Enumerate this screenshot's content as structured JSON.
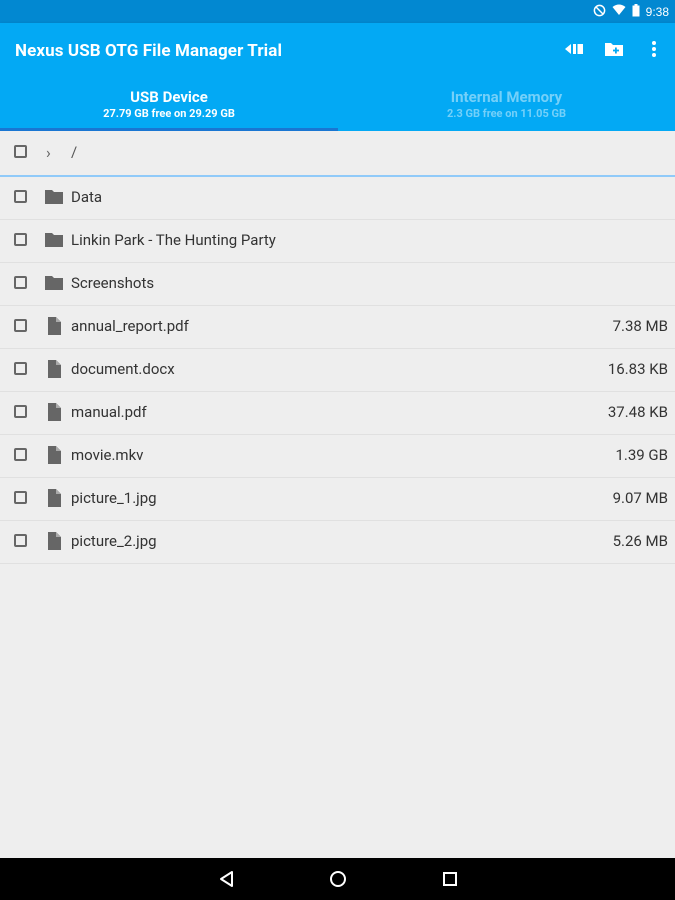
{
  "status_bar": {
    "time": "9:38",
    "icons": [
      "do-not-disturb-icon",
      "wifi-icon",
      "battery-icon"
    ]
  },
  "app_bar": {
    "title": "Nexus USB OTG File Manager Trial",
    "actions": [
      "sort-icon",
      "new-folder-icon",
      "overflow-menu-icon"
    ],
    "colors": {
      "primary": "#03a9f4",
      "status": "#0288d1",
      "indicator": "#1976d2"
    }
  },
  "tabs": [
    {
      "label": "USB Device",
      "sublabel": "27.79 GB free on 29.29 GB",
      "active": true
    },
    {
      "label": "Internal Memory",
      "sublabel": "2.3 GB free on 11.05 GB",
      "active": false
    }
  ],
  "path": {
    "current": "/"
  },
  "files": [
    {
      "name": "Data",
      "type": "folder",
      "size": ""
    },
    {
      "name": "Linkin Park - The Hunting Party",
      "type": "folder",
      "size": ""
    },
    {
      "name": "Screenshots",
      "type": "folder",
      "size": ""
    },
    {
      "name": "annual_report.pdf",
      "type": "file",
      "size": "7.38 MB"
    },
    {
      "name": "document.docx",
      "type": "file",
      "size": "16.83 KB"
    },
    {
      "name": "manual.pdf",
      "type": "file",
      "size": "37.48 KB"
    },
    {
      "name": "movie.mkv",
      "type": "file",
      "size": "1.39 GB"
    },
    {
      "name": "picture_1.jpg",
      "type": "file",
      "size": "9.07 MB"
    },
    {
      "name": "picture_2.jpg",
      "type": "file",
      "size": "5.26 MB"
    }
  ],
  "nav_bar": [
    "back-icon",
    "home-icon",
    "recents-icon"
  ]
}
